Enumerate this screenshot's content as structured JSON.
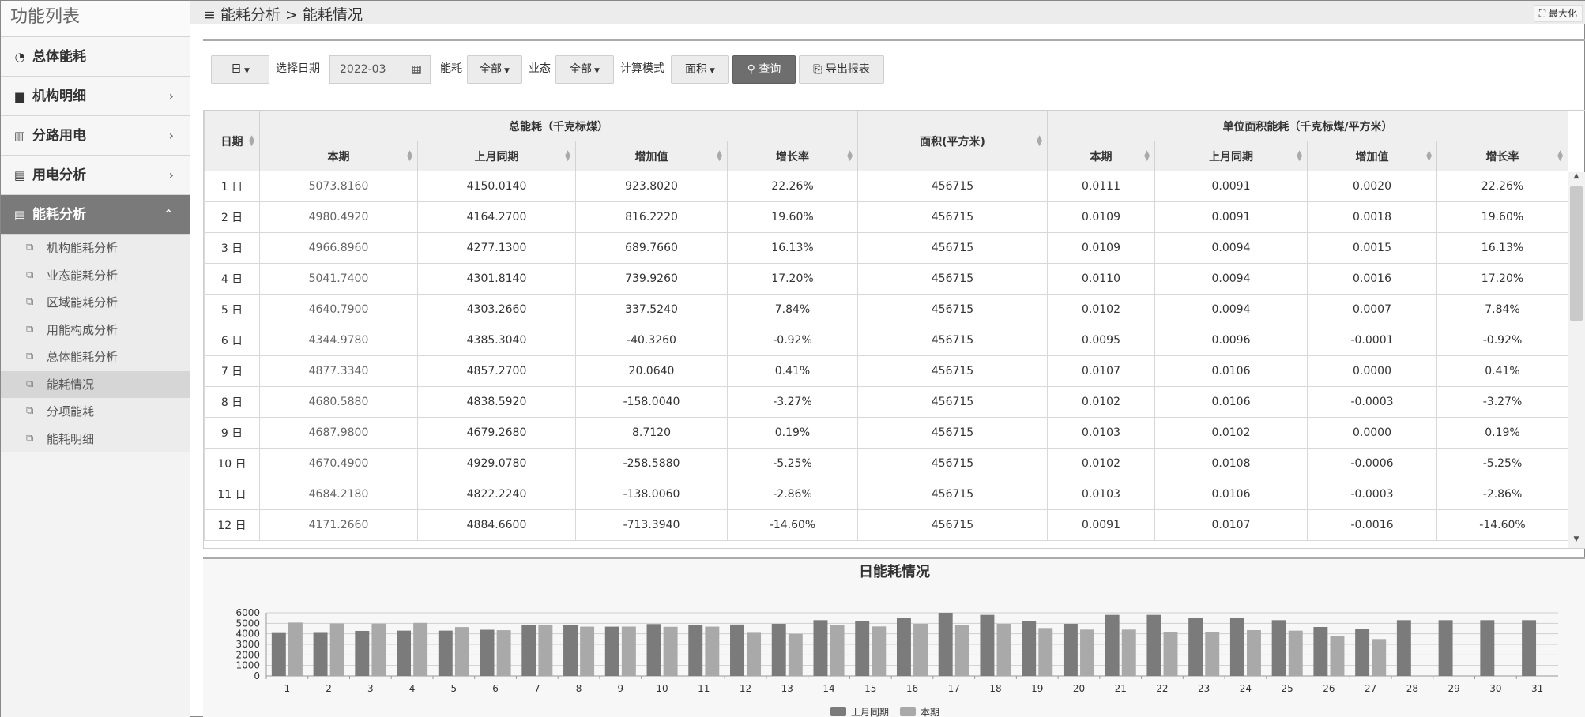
{
  "sidebar": {
    "title": "功能列表",
    "items": [
      {
        "label": "总体能耗",
        "icon": "dashboard-icon",
        "glyph": "◔",
        "chevron": ""
      },
      {
        "label": "机构明细",
        "icon": "briefcase-icon",
        "glyph": "▆",
        "chevron": "›"
      },
      {
        "label": "分路用电",
        "icon": "bar-chart-icon",
        "glyph": "▥",
        "chevron": "›"
      },
      {
        "label": "用电分析",
        "icon": "document-icon",
        "glyph": "▤",
        "chevron": "›"
      },
      {
        "label": "能耗分析",
        "icon": "document-icon",
        "glyph": "▤",
        "chevron": "⌃"
      }
    ],
    "subitems": [
      {
        "label": "机构能耗分析"
      },
      {
        "label": "业态能耗分析"
      },
      {
        "label": "区域能耗分析"
      },
      {
        "label": "用能构成分析"
      },
      {
        "label": "总体能耗分析"
      },
      {
        "label": "能耗情况"
      },
      {
        "label": "分项能耗"
      },
      {
        "label": "能耗明细"
      }
    ],
    "sub_icon": "copy-icon"
  },
  "header": {
    "breadcrumb": "≡ 能耗分析 > 能耗情况",
    "maximize_label": "最大化",
    "maximize_glyph": "⛶"
  },
  "toolbar": {
    "period_label": "日",
    "date_label": "选择日期",
    "date_value": "2022-03",
    "energy_label": "能耗",
    "energy_value": "全部",
    "business_label": "业态",
    "business_value": "全部",
    "mode_label": "计算模式",
    "mode_value": "面积",
    "query_label": "查询",
    "export_label": "导出报表"
  },
  "table": {
    "headers": {
      "date": "日期",
      "total_group": "总能耗（千克标煤）",
      "area": "面积(平方米)",
      "unit_group": "单位面积能耗（千克标煤/平方米）",
      "current": "本期",
      "last_month": "上月同期",
      "increase": "增加值",
      "growth": "增长率"
    },
    "rows": [
      [
        "1 日",
        "5073.8160",
        "4150.0140",
        "923.8020",
        "22.26%",
        "456715",
        "0.0111",
        "0.0091",
        "0.0020",
        "22.26%"
      ],
      [
        "2 日",
        "4980.4920",
        "4164.2700",
        "816.2220",
        "19.60%",
        "456715",
        "0.0109",
        "0.0091",
        "0.0018",
        "19.60%"
      ],
      [
        "3 日",
        "4966.8960",
        "4277.1300",
        "689.7660",
        "16.13%",
        "456715",
        "0.0109",
        "0.0094",
        "0.0015",
        "16.13%"
      ],
      [
        "4 日",
        "5041.7400",
        "4301.8140",
        "739.9260",
        "17.20%",
        "456715",
        "0.0110",
        "0.0094",
        "0.0016",
        "17.20%"
      ],
      [
        "5 日",
        "4640.7900",
        "4303.2660",
        "337.5240",
        "7.84%",
        "456715",
        "0.0102",
        "0.0094",
        "0.0007",
        "7.84%"
      ],
      [
        "6 日",
        "4344.9780",
        "4385.3040",
        "-40.3260",
        "-0.92%",
        "456715",
        "0.0095",
        "0.0096",
        "-0.0001",
        "-0.92%"
      ],
      [
        "7 日",
        "4877.3340",
        "4857.2700",
        "20.0640",
        "0.41%",
        "456715",
        "0.0107",
        "0.0106",
        "0.0000",
        "0.41%"
      ],
      [
        "8 日",
        "4680.5880",
        "4838.5920",
        "-158.0040",
        "-3.27%",
        "456715",
        "0.0102",
        "0.0106",
        "-0.0003",
        "-3.27%"
      ],
      [
        "9 日",
        "4687.9800",
        "4679.2680",
        "8.7120",
        "0.19%",
        "456715",
        "0.0103",
        "0.0102",
        "0.0000",
        "0.19%"
      ],
      [
        "10 日",
        "4670.4900",
        "4929.0780",
        "-258.5880",
        "-5.25%",
        "456715",
        "0.0102",
        "0.0108",
        "-0.0006",
        "-5.25%"
      ],
      [
        "11 日",
        "4684.2180",
        "4822.2240",
        "-138.0060",
        "-2.86%",
        "456715",
        "0.0103",
        "0.0106",
        "-0.0003",
        "-2.86%"
      ],
      [
        "12 日",
        "4171.2660",
        "4884.6600",
        "-713.3940",
        "-14.60%",
        "456715",
        "0.0091",
        "0.0107",
        "-0.0016",
        "-14.60%"
      ]
    ]
  },
  "chart_data": {
    "type": "bar",
    "title": "日能耗情况",
    "categories": [
      "1",
      "2",
      "3",
      "4",
      "5",
      "6",
      "7",
      "8",
      "9",
      "10",
      "11",
      "12",
      "13",
      "14",
      "15",
      "16",
      "17",
      "18",
      "19",
      "20",
      "21",
      "22",
      "23",
      "24",
      "25",
      "26",
      "27",
      "28",
      "29",
      "30",
      "31"
    ],
    "series": [
      {
        "name": "上月同期",
        "color": "#7b7b7b",
        "values": [
          4150,
          4164,
          4277,
          4302,
          4303,
          4385,
          4857,
          4839,
          4679,
          4929,
          4822,
          4885,
          4950,
          5300,
          5250,
          5550,
          6000,
          5800,
          5200,
          4950,
          5800,
          5800,
          5550,
          5550,
          5300,
          4650,
          4500,
          5300,
          5300,
          5300,
          5300
        ]
      },
      {
        "name": "本期",
        "color": "#a9a9a9",
        "values": [
          5074,
          4980,
          4967,
          5042,
          4641,
          4345,
          4877,
          4681,
          4688,
          4670,
          4684,
          4171,
          4000,
          4800,
          4700,
          4950,
          4850,
          4950,
          4550,
          4400,
          4400,
          4200,
          4200,
          4350,
          4300,
          3800,
          3500,
          null,
          null,
          null,
          null
        ]
      }
    ],
    "yticks": [
      0,
      1000,
      2000,
      3000,
      4000,
      5000,
      6000
    ],
    "ylim": [
      0,
      6000
    ],
    "grid": true,
    "legend": "bottom"
  }
}
